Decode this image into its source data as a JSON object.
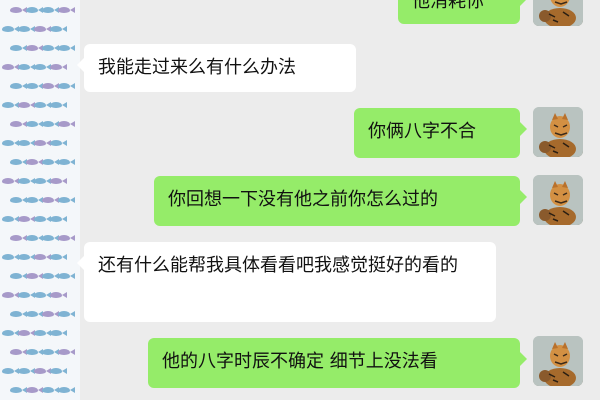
{
  "messages": [
    {
      "side": "out",
      "text": "他消耗你"
    },
    {
      "side": "in",
      "text": "我能走过来么有什么办法"
    },
    {
      "side": "out",
      "text": "你俩八字不合"
    },
    {
      "side": "out",
      "text": "你回想一下没有他之前你怎么过的"
    },
    {
      "side": "in",
      "text": "还有什么能帮我具体看看吧我感觉挺好的看的"
    },
    {
      "side": "out",
      "text": "他的八字时辰不确定 细节上没法看"
    }
  ],
  "colors": {
    "background": "#ececec",
    "outgoing_bubble": "#95ec69",
    "incoming_bubble": "#ffffff"
  },
  "icons": {
    "contact_avatar": "fish-pattern-avatar-icon",
    "user_avatar": "tiger-avatar-icon"
  }
}
